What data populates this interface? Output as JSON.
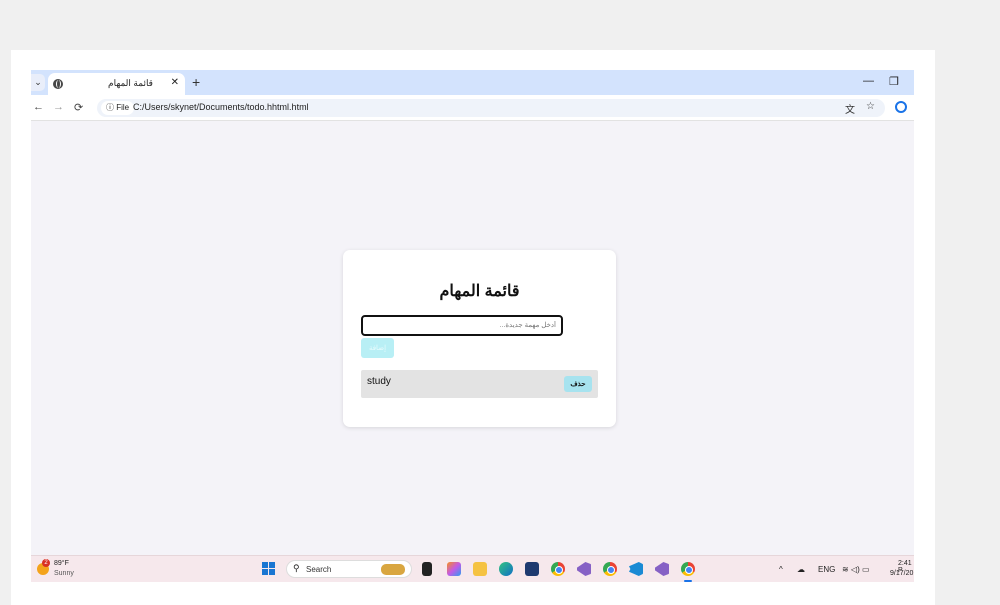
{
  "browser": {
    "tab_title": "قائمة المهام",
    "new_tab": "+",
    "tab_close": "✕",
    "tab_scroll": "⌄",
    "file_chip": "ⓘ File",
    "url": "C:/Users/skynet/Documents/todo.hhtml.html",
    "back": "←",
    "forward": "→",
    "reload": "⟳",
    "minimize": "—",
    "restore": "❐",
    "star": "☆",
    "translate": "⽂"
  },
  "app": {
    "title": "قائمة المهام",
    "input_placeholder": "أدخل مهمة جديدة...",
    "add_label": "إضافة",
    "tasks": [
      {
        "text": "study",
        "delete_label": "حذف"
      }
    ]
  },
  "taskbar": {
    "weather_badge": "2",
    "weather_temp": "89°F",
    "weather_cond": "Sunny",
    "search_label": "Search",
    "search_icon": "⚲",
    "tray_chevron": "^",
    "tray_lang": "ENG",
    "tray_icons": "☁",
    "tray_net": "≋ ◁) ▭",
    "time": "2:41 P",
    "date": "9/17/20"
  },
  "colors": {
    "accent": "#1a73e8",
    "add_button": "#b8eff5",
    "delete_button": "#a7e3ef",
    "task_row": "#e3e3e3"
  }
}
